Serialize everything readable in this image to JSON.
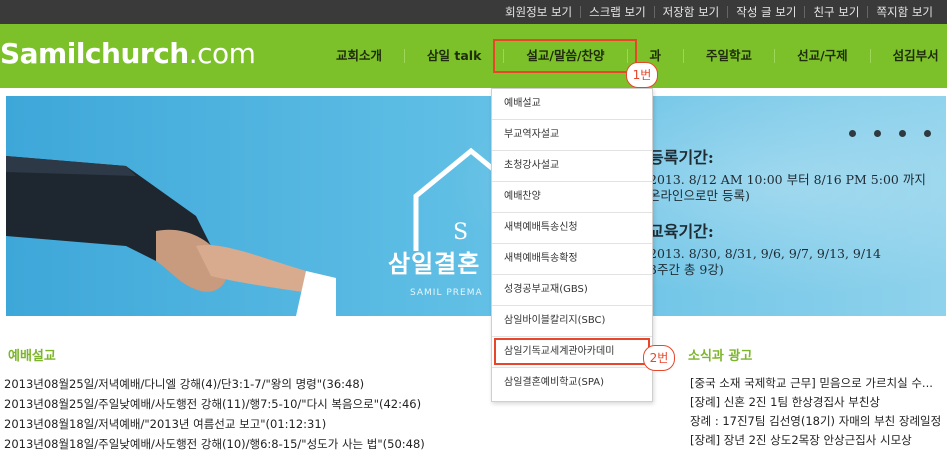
{
  "topbar": {
    "links": [
      "회원정보 보기",
      "스크랩 보기",
      "저장함 보기",
      "작성 글 보기",
      "친구 보기",
      "쪽지함 보기"
    ]
  },
  "header": {
    "logo_main": "Samilchurch",
    "logo_domain": ".com",
    "nav": [
      "교회소개",
      "삼일 talk",
      "설교/말씀/찬양",
      "",
      "주일학교",
      "선교/구제",
      "섬김부서"
    ],
    "nav_partial": "과",
    "accent": "#7dc12a",
    "highlight": "#e8462b"
  },
  "annotations": {
    "badge1": "1번",
    "badge2": "2번"
  },
  "dropdown": {
    "items": [
      "예배설교",
      "부교역자설교",
      "초청강사설교",
      "예배찬양",
      "새벽예배특송신청",
      "새벽예배특송확정",
      "성경공부교재(GBS)",
      "삼일바이블칼리지(SBC)",
      "삼일기독교세계관아카데미",
      "삼일결혼예비학교(SPA)"
    ]
  },
  "hero": {
    "house_letter": "S",
    "title": "삼일결혼",
    "subtitle": "SAMIL PREMA",
    "reg_head": "등록기간:",
    "reg_line1": "2013. 8/12 AM 10:00 부터 8/16 PM 5:00 까지",
    "reg_line2": "온라인으로만 등록)",
    "edu_head": "교육기간:",
    "edu_line1": "2013. 8/30, 8/31, 9/6, 9/7, 9/13, 9/14",
    "edu_line2": "3주간 총 9강)"
  },
  "sermons": {
    "title": "예배설교",
    "posts": [
      "2013년08월25일/저녁예배/다니엘 강해(4)/단3:1-7/\"왕의 명령\"(36:48)",
      "2013년08월25일/주일낮예배/사도행전 강해(11)/행7:5-10/\"다시 복음으로\"(42:46)",
      "2013년08월18일/저녁예배/\"2013년 여름선교 보고\"(01:12:31)",
      "2013년08월18일/주일낮예배/사도행전 강해(10)/행6:8-15/\"성도가 사는 법\"(50:48)"
    ]
  },
  "news": {
    "title": "소식과 광고",
    "items": [
      "[중국 소재 국제학교 근무] 믿음으로 가르치실 수...",
      "[장례] 신혼 2진 1팀 한상경집사 부친상",
      "장례 : 17진7팀 김선영(18기) 자매의 부친 장례일정",
      "[장례] 장년 2진 상도2목장 안상근집사 시모상"
    ]
  }
}
